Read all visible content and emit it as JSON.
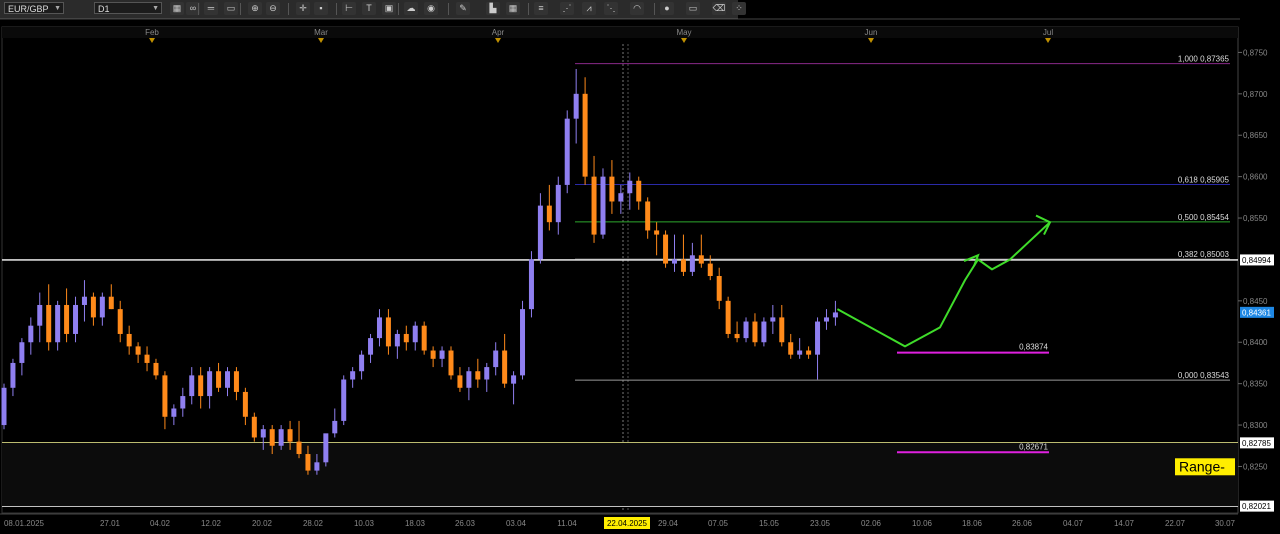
{
  "toolbar": {
    "symbol": "EUR/GBP",
    "timeframe": "D1",
    "buttons": [
      {
        "name": "chart-type-icon",
        "glyph": "▦"
      },
      {
        "name": "template-icon",
        "glyph": "∞"
      },
      {
        "name": "line-tool-icon",
        "glyph": "═"
      },
      {
        "name": "horizontal-line-icon",
        "glyph": "▭"
      },
      {
        "name": "zoom-in-icon",
        "glyph": "⊕"
      },
      {
        "name": "zoom-out-icon",
        "glyph": "⊖"
      },
      {
        "name": "crosshair-icon",
        "glyph": "✛"
      },
      {
        "name": "cursor-icon",
        "glyph": "▪"
      },
      {
        "name": "trend-icon",
        "glyph": "⊢"
      },
      {
        "name": "text-tool-icon",
        "glyph": "T"
      },
      {
        "name": "save-icon",
        "glyph": "▣"
      },
      {
        "name": "cloud-icon",
        "glyph": "☁"
      },
      {
        "name": "globe-icon",
        "glyph": "◉"
      },
      {
        "name": "pencil-icon",
        "glyph": "✎"
      },
      {
        "name": "indicator-icon",
        "glyph": "▙"
      },
      {
        "name": "grid-icon",
        "glyph": "▦"
      },
      {
        "name": "fibonacci-icon",
        "glyph": "≡"
      },
      {
        "name": "channel-icon",
        "glyph": "⋰"
      },
      {
        "name": "pitchfork-icon",
        "glyph": "⩘"
      },
      {
        "name": "gann-icon",
        "glyph": "⋱"
      },
      {
        "name": "arc-icon",
        "glyph": "◠"
      },
      {
        "name": "ellipse-icon",
        "glyph": "●"
      },
      {
        "name": "objects-icon",
        "glyph": "▭"
      },
      {
        "name": "eraser-icon",
        "glyph": "⌫"
      },
      {
        "name": "settings-icon",
        "glyph": "⁘"
      }
    ]
  },
  "chart_data": {
    "type": "candlestick",
    "symbol": "EUR/GBP",
    "timeframe": "D1",
    "month_labels": [
      "Feb",
      "Mar",
      "Apr",
      "May",
      "Jun",
      "Jul"
    ],
    "date_labels": [
      "08.01.2025",
      "27.01",
      "04.02",
      "12.02",
      "20.02",
      "28.02",
      "10.03",
      "18.03",
      "26.03",
      "03.04",
      "11.04",
      "22.04.2025",
      "29.04",
      "07.05",
      "15.05",
      "23.05",
      "02.06",
      "10.06",
      "18.06",
      "26.06",
      "04.07",
      "14.07",
      "22.07",
      "30.07"
    ],
    "highlighted_date": "22.04.2025",
    "price_ticks": [
      "0,8750",
      "0,8700",
      "0,8650",
      "0,8600",
      "0,8550",
      "0,8450",
      "0,8400",
      "0,8350",
      "0,8300",
      "0,8250"
    ],
    "ylim": [
      0.8195,
      0.8765
    ],
    "current_price": "0,84361",
    "horizontal_levels": [
      {
        "price": 0.84994,
        "label": "0,84994",
        "color": "#ffffff"
      },
      {
        "price": 0.82785,
        "label": "0,82785",
        "color": "#ffff99"
      },
      {
        "price": 0.82021,
        "label": "0,82021",
        "color": "#ffffff"
      }
    ],
    "fibonacci": [
      {
        "ratio": "1,000",
        "price": 0.87365,
        "label": "1,000 0,87365",
        "color": "#8a2a8a"
      },
      {
        "ratio": "0,618",
        "price": 0.85905,
        "label": "0,618 0,85905",
        "color": "#2a2aa8"
      },
      {
        "ratio": "0,500",
        "price": 0.85454,
        "label": "0,500 0,85454",
        "color": "#2ea82e"
      },
      {
        "ratio": "0,382",
        "price": 0.85003,
        "label": "0,382 0,85003",
        "color": "#bbbbbb"
      },
      {
        "ratio": "0,000",
        "price": 0.83543,
        "label": "0,000 0,83543",
        "color": "#999999"
      }
    ],
    "target_levels": [
      {
        "price": 0.83874,
        "label": "0,83874",
        "color": "#e020e0"
      },
      {
        "price": 0.82671,
        "label": "0,82671",
        "color": "#e020e0"
      }
    ],
    "annotation": {
      "text": "Range-",
      "background": "#ffee00"
    },
    "projection_path": [
      [
        0.844,
        0.845
      ],
      [
        0.8395,
        0.8388
      ],
      [
        0.8418,
        0.846
      ],
      [
        0.8475,
        0.849
      ],
      [
        0.85,
        0.8505
      ],
      [
        0.8488,
        0.8478
      ],
      [
        0.85,
        0.8525
      ],
      [
        0.8545,
        0.8555
      ]
    ],
    "colors": {
      "bull": "#8f7ff0",
      "bear": "#ff8a1a",
      "projection": "#3fdc2a",
      "price_tag": "#1e88e5"
    },
    "candles": [
      [
        0.83,
        0.835,
        0.8295,
        0.8345
      ],
      [
        0.8345,
        0.838,
        0.8335,
        0.8375
      ],
      [
        0.8375,
        0.8405,
        0.836,
        0.84
      ],
      [
        0.84,
        0.843,
        0.8385,
        0.842
      ],
      [
        0.842,
        0.846,
        0.84,
        0.8445
      ],
      [
        0.8445,
        0.847,
        0.839,
        0.84
      ],
      [
        0.84,
        0.845,
        0.839,
        0.8445
      ],
      [
        0.8445,
        0.8465,
        0.84,
        0.841
      ],
      [
        0.841,
        0.8455,
        0.84,
        0.8445
      ],
      [
        0.8445,
        0.8475,
        0.8425,
        0.8455
      ],
      [
        0.8455,
        0.846,
        0.842,
        0.843
      ],
      [
        0.843,
        0.846,
        0.842,
        0.8455
      ],
      [
        0.8455,
        0.847,
        0.844,
        0.844
      ],
      [
        0.844,
        0.845,
        0.84,
        0.841
      ],
      [
        0.841,
        0.842,
        0.8385,
        0.8395
      ],
      [
        0.8395,
        0.84,
        0.8375,
        0.8385
      ],
      [
        0.8385,
        0.8395,
        0.8365,
        0.8375
      ],
      [
        0.8375,
        0.838,
        0.8355,
        0.836
      ],
      [
        0.836,
        0.8365,
        0.8295,
        0.831
      ],
      [
        0.831,
        0.8325,
        0.83,
        0.832
      ],
      [
        0.832,
        0.8345,
        0.831,
        0.8335
      ],
      [
        0.8335,
        0.837,
        0.8325,
        0.836
      ],
      [
        0.836,
        0.837,
        0.832,
        0.8335
      ],
      [
        0.8335,
        0.837,
        0.832,
        0.8365
      ],
      [
        0.8365,
        0.8375,
        0.834,
        0.8345
      ],
      [
        0.8345,
        0.837,
        0.8335,
        0.8365
      ],
      [
        0.8365,
        0.837,
        0.833,
        0.834
      ],
      [
        0.834,
        0.8345,
        0.83,
        0.831
      ],
      [
        0.831,
        0.8315,
        0.828,
        0.8285
      ],
      [
        0.8285,
        0.83,
        0.827,
        0.8295
      ],
      [
        0.8295,
        0.83,
        0.8265,
        0.8275
      ],
      [
        0.8275,
        0.83,
        0.827,
        0.8295
      ],
      [
        0.8295,
        0.8305,
        0.827,
        0.828
      ],
      [
        0.828,
        0.8305,
        0.826,
        0.8265
      ],
      [
        0.8265,
        0.8275,
        0.824,
        0.8245
      ],
      [
        0.8245,
        0.8265,
        0.824,
        0.8255
      ],
      [
        0.8255,
        0.828,
        0.825,
        0.829
      ],
      [
        0.829,
        0.832,
        0.8285,
        0.8305
      ],
      [
        0.8305,
        0.836,
        0.83,
        0.8355
      ],
      [
        0.8355,
        0.837,
        0.8345,
        0.8365
      ],
      [
        0.8365,
        0.839,
        0.8355,
        0.8385
      ],
      [
        0.8385,
        0.841,
        0.8375,
        0.8405
      ],
      [
        0.8405,
        0.844,
        0.8395,
        0.843
      ],
      [
        0.843,
        0.844,
        0.8385,
        0.8395
      ],
      [
        0.8395,
        0.8415,
        0.838,
        0.841
      ],
      [
        0.841,
        0.842,
        0.839,
        0.84
      ],
      [
        0.84,
        0.8425,
        0.839,
        0.842
      ],
      [
        0.842,
        0.8425,
        0.8385,
        0.839
      ],
      [
        0.839,
        0.8395,
        0.837,
        0.838
      ],
      [
        0.838,
        0.8395,
        0.837,
        0.839
      ],
      [
        0.839,
        0.8395,
        0.8355,
        0.836
      ],
      [
        0.836,
        0.837,
        0.834,
        0.8345
      ],
      [
        0.8345,
        0.837,
        0.833,
        0.8365
      ],
      [
        0.8365,
        0.838,
        0.8345,
        0.8355
      ],
      [
        0.8355,
        0.8375,
        0.834,
        0.837
      ],
      [
        0.837,
        0.84,
        0.836,
        0.839
      ],
      [
        0.839,
        0.841,
        0.8345,
        0.835
      ],
      [
        0.835,
        0.8365,
        0.8325,
        0.836
      ],
      [
        0.836,
        0.845,
        0.8355,
        0.844
      ],
      [
        0.844,
        0.851,
        0.843,
        0.85
      ],
      [
        0.85,
        0.858,
        0.8495,
        0.8565
      ],
      [
        0.8565,
        0.859,
        0.8535,
        0.8545
      ],
      [
        0.8545,
        0.86,
        0.853,
        0.859
      ],
      [
        0.859,
        0.868,
        0.858,
        0.867
      ],
      [
        0.867,
        0.873,
        0.864,
        0.87
      ],
      [
        0.87,
        0.872,
        0.859,
        0.86
      ],
      [
        0.86,
        0.8625,
        0.852,
        0.853
      ],
      [
        0.853,
        0.861,
        0.8525,
        0.86
      ],
      [
        0.86,
        0.862,
        0.8555,
        0.857
      ],
      [
        0.857,
        0.859,
        0.8555,
        0.858
      ],
      [
        0.858,
        0.8605,
        0.856,
        0.8595
      ],
      [
        0.8595,
        0.86,
        0.856,
        0.857
      ],
      [
        0.857,
        0.8575,
        0.8525,
        0.8535
      ],
      [
        0.8535,
        0.8545,
        0.8505,
        0.853
      ],
      [
        0.853,
        0.8535,
        0.849,
        0.8495
      ],
      [
        0.8495,
        0.853,
        0.8485,
        0.85
      ],
      [
        0.85,
        0.853,
        0.848,
        0.8485
      ],
      [
        0.8485,
        0.852,
        0.848,
        0.8505
      ],
      [
        0.8505,
        0.853,
        0.849,
        0.8495
      ],
      [
        0.8495,
        0.8505,
        0.8475,
        0.848
      ],
      [
        0.848,
        0.849,
        0.844,
        0.845
      ],
      [
        0.845,
        0.8455,
        0.8405,
        0.841
      ],
      [
        0.841,
        0.8425,
        0.84,
        0.8405
      ],
      [
        0.8405,
        0.843,
        0.84,
        0.8425
      ],
      [
        0.8425,
        0.8435,
        0.8395,
        0.84
      ],
      [
        0.84,
        0.843,
        0.8395,
        0.8425
      ],
      [
        0.8425,
        0.8445,
        0.841,
        0.843
      ],
      [
        0.843,
        0.8445,
        0.8395,
        0.84
      ],
      [
        0.84,
        0.841,
        0.838,
        0.8385
      ],
      [
        0.8385,
        0.8405,
        0.838,
        0.839
      ],
      [
        0.839,
        0.8395,
        0.838,
        0.8385
      ],
      [
        0.8385,
        0.843,
        0.8355,
        0.8425
      ],
      [
        0.8425,
        0.844,
        0.8415,
        0.843
      ],
      [
        0.843,
        0.845,
        0.842,
        0.8436
      ]
    ]
  }
}
